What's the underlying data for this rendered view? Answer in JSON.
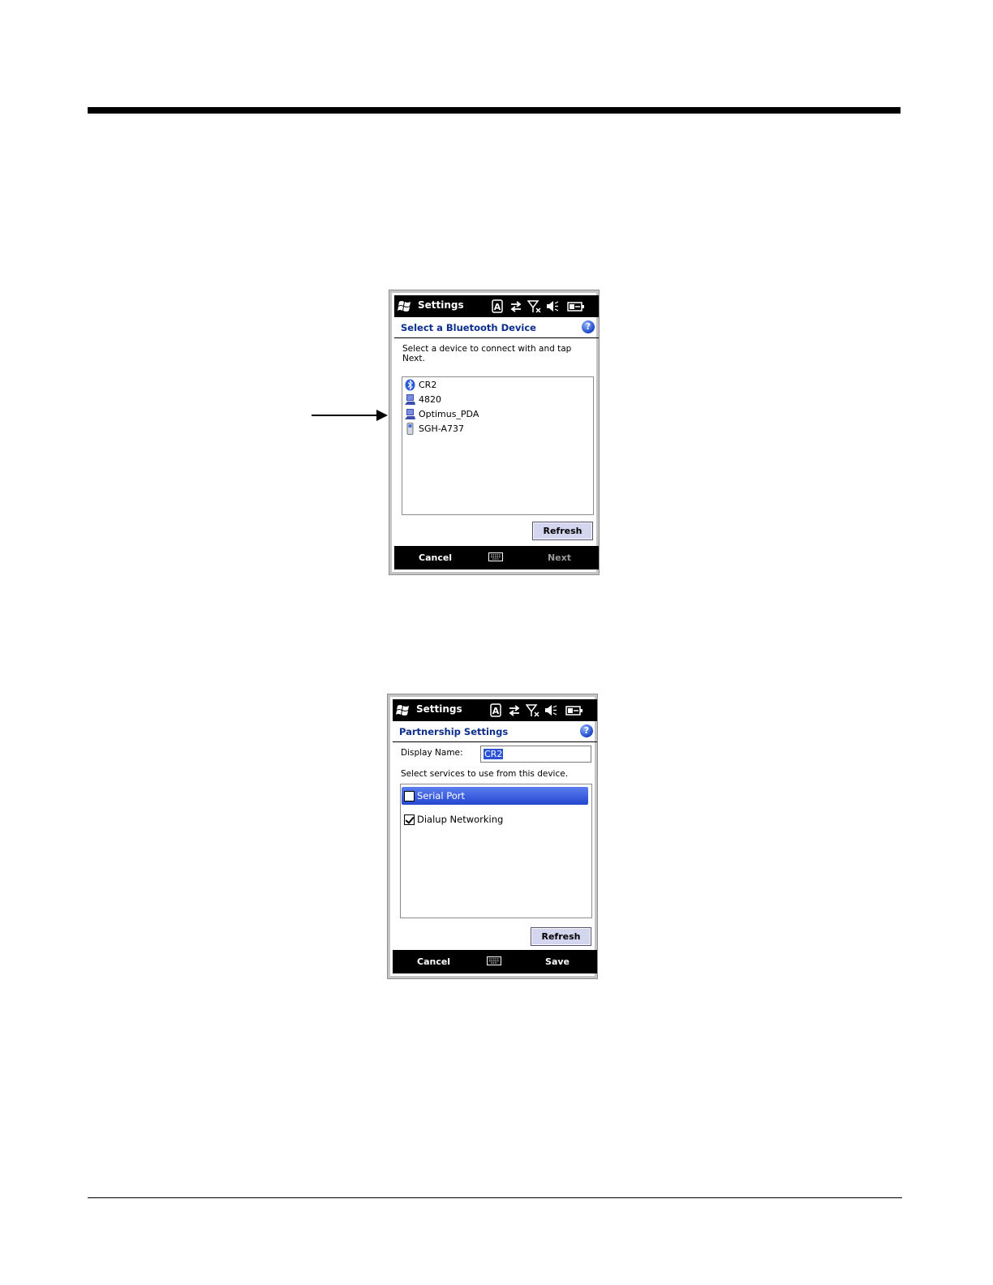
{
  "screen1": {
    "status_bar": {
      "app_title": "Settings",
      "icons": [
        "windows-start-icon",
        "input-mode-icon",
        "sync-arrows-icon",
        "no-signal-icon",
        "speaker-muted-icon",
        "battery-icon"
      ]
    },
    "header": {
      "title": "Select a Bluetooth Device",
      "help_icon_glyph": "?"
    },
    "instruction": "Select a device to connect with and tap Next.",
    "devices": [
      {
        "label": "CR2",
        "icon": "bluetooth-icon"
      },
      {
        "label": "4820",
        "icon": "computer-icon"
      },
      {
        "label": "Optimus_PDA",
        "icon": "computer-icon"
      },
      {
        "label": "SGH-A737",
        "icon": "phone-icon"
      }
    ],
    "refresh_label": "Refresh",
    "softkeys": {
      "left": "Cancel",
      "right": "Next",
      "right_enabled": false,
      "center_icon": "keyboard-icon"
    }
  },
  "screen2": {
    "status_bar": {
      "app_title": "Settings",
      "icons": [
        "windows-start-icon",
        "input-mode-icon",
        "sync-arrows-icon",
        "no-signal-icon",
        "speaker-muted-icon",
        "battery-icon"
      ]
    },
    "header": {
      "title": "Partnership Settings",
      "help_icon_glyph": "?"
    },
    "display_name_label": "Display Name:",
    "display_name_value": "CR2",
    "services_instruction": "Select services to use from this device.",
    "services": [
      {
        "label": "Serial Port",
        "checked": false,
        "selected": true
      },
      {
        "label": "Dialup Networking",
        "checked": true,
        "selected": false
      }
    ],
    "refresh_label": "Refresh",
    "softkeys": {
      "left": "Cancel",
      "right": "Save",
      "center_icon": "keyboard-icon"
    }
  },
  "colors": {
    "header_title": "#0c2e8c",
    "selection": "#2447cf",
    "button_face": "#d4d6f0",
    "bar_background": "#000000"
  }
}
